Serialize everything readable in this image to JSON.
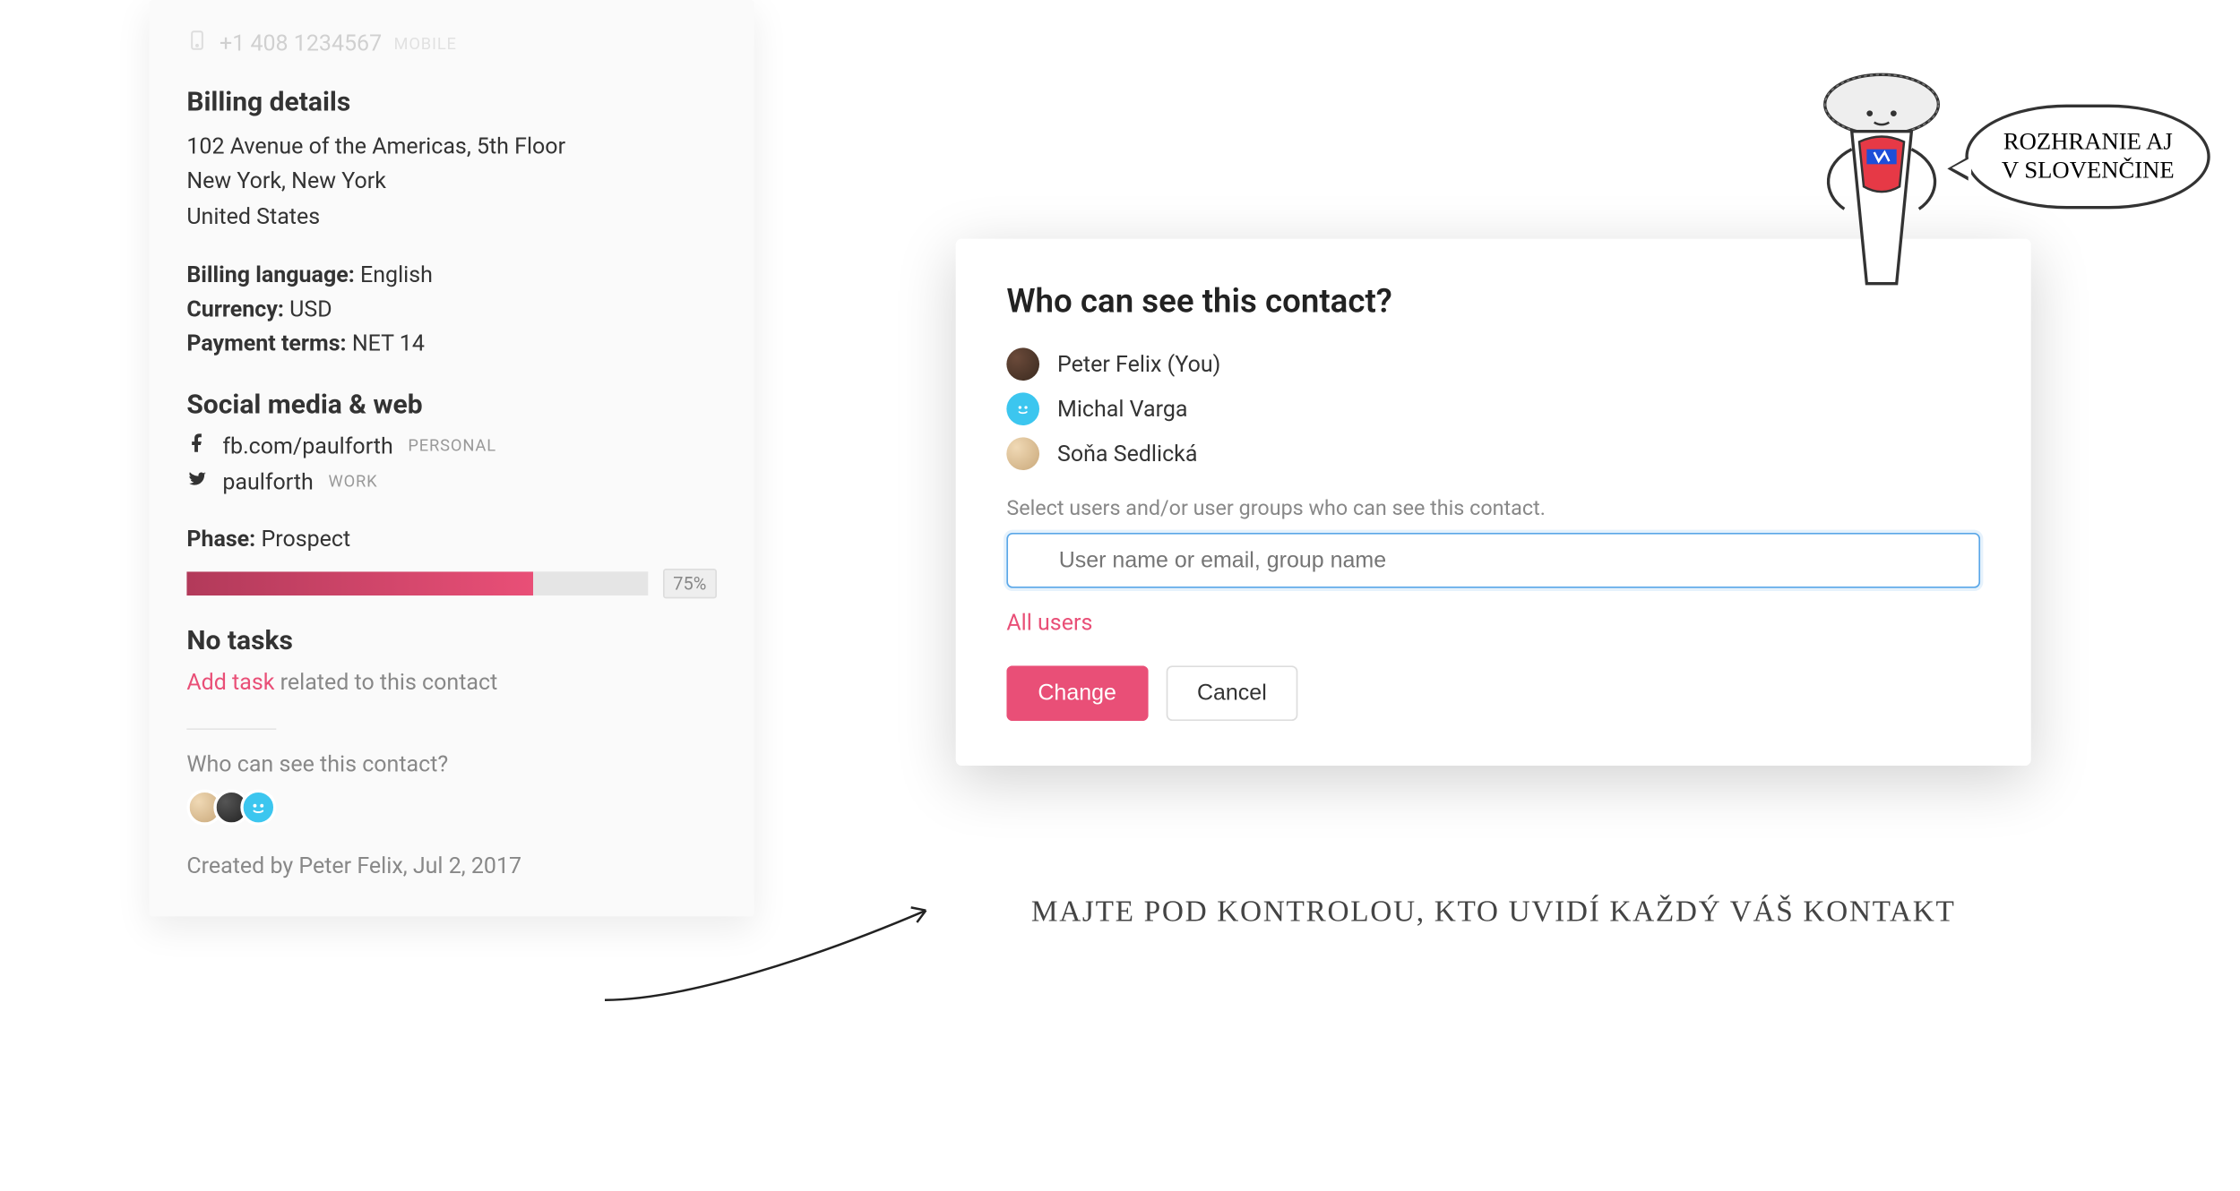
{
  "contact": {
    "phone": "+1 408 1234567",
    "phone_label": "MOBILE",
    "billing_title": "Billing details",
    "address_line1": "102 Avenue of the Americas, 5th Floor",
    "address_line2": "New York, New York",
    "address_line3": "United States",
    "billing_language_label": "Billing language:",
    "billing_language": "English",
    "currency_label": "Currency:",
    "currency": "USD",
    "payment_terms_label": "Payment terms:",
    "payment_terms": "NET 14",
    "social_title": "Social media & web",
    "facebook": "fb.com/paulforth",
    "facebook_tag": "PERSONAL",
    "twitter": "paulforth",
    "twitter_tag": "WORK",
    "phase_label": "Phase:",
    "phase": "Prospect",
    "phase_pct": "75%",
    "no_tasks_title": "No tasks",
    "add_task_link": "Add task",
    "add_task_rest": " related to this contact",
    "visibility_q": "Who can see this contact?",
    "created_by": "Created by Peter Felix, Jul 2, 2017"
  },
  "popup": {
    "title": "Who can see this contact?",
    "users": [
      {
        "name": "Peter Felix (You)"
      },
      {
        "name": "Michal Varga"
      },
      {
        "name": "Soňa Sedlická"
      }
    ],
    "help": "Select users and/or user groups who can see this contact.",
    "placeholder": "User name or email, group name",
    "all_users": "All users",
    "change": "Change",
    "cancel": "Cancel"
  },
  "annotations": {
    "caption": "MAJTE POD KONTROLOU, KTO UVIDÍ KAŽDÝ VÁŠ KONTAKT",
    "bubble_line1": "ROZHRANIE AJ",
    "bubble_line2": "V SLOVENČINE"
  }
}
